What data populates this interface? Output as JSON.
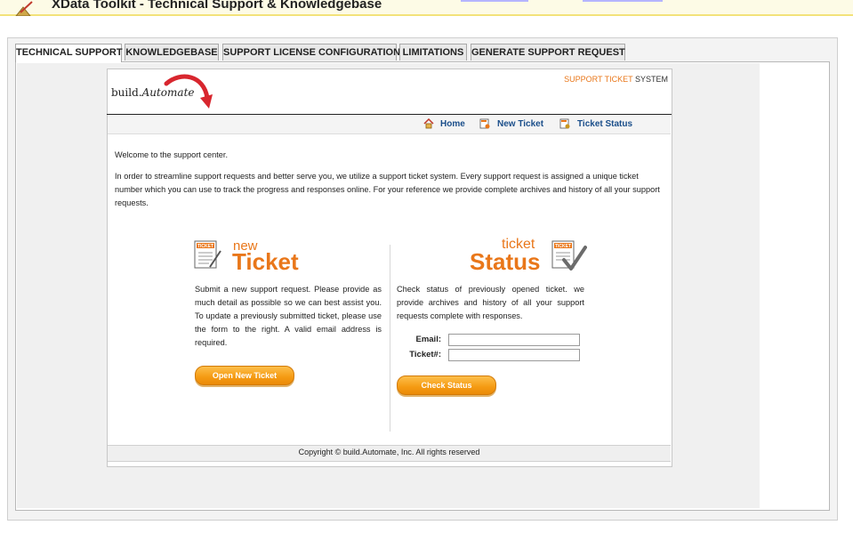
{
  "app": {
    "title": "XData Toolkit - Technical Support & Knowledgebase"
  },
  "tabs": [
    {
      "label": "TECHNICAL SUPPORT",
      "active": true
    },
    {
      "label": "KNOWLEDGEBASE",
      "active": false
    },
    {
      "label": "SUPPORT LICENSE CONFIGURATION",
      "active": false
    },
    {
      "label": "LIMITATIONS",
      "active": false
    },
    {
      "label": "GENERATE SUPPORT REQUEST",
      "active": false
    }
  ],
  "header": {
    "logo_prefix": "build.",
    "logo_brand": "Automate",
    "system_title_highlight": "SUPPORT TICKET",
    "system_title_rest": " SYSTEM"
  },
  "nav": {
    "home": "Home",
    "new_ticket": "New Ticket",
    "ticket_status": "Ticket Status"
  },
  "content": {
    "welcome": "Welcome to the support center.",
    "intro": "In order to streamline support requests and better serve you, we utilize a support ticket system. Every support request is assigned a unique ticket number which you can use to track the progress and responses online. For your reference we provide complete archives and history of all your support requests."
  },
  "new_ticket": {
    "small_word": "new",
    "big_word": "Ticket",
    "stamp": "TICKET",
    "description": "Submit a new support request. Please provide as much detail as possible so we can best assist you. To update a previously submitted ticket, please use the form to the right. A valid email address is required.",
    "button": "Open New Ticket"
  },
  "ticket_status": {
    "small_word": "ticket",
    "big_word": "Status",
    "stamp": "TICKET",
    "description": "Check status of previously opened ticket. we provide archives and history of all your support requests complete with responses.",
    "email_label": "Email:",
    "ticket_label": "Ticket#:",
    "email_value": "",
    "ticket_value": "",
    "button": "Check Status"
  },
  "footer": {
    "copyright": "Copyright © build.Automate, Inc. All rights reserved"
  },
  "colors": {
    "accent_orange": "#e9771a",
    "nav_blue": "#1a4e8a"
  },
  "icons": [
    "app-icon",
    "home-icon",
    "new-ticket-icon",
    "ticket-status-icon",
    "ticket-doc-icon",
    "ticket-check-icon",
    "logo-swoosh"
  ]
}
